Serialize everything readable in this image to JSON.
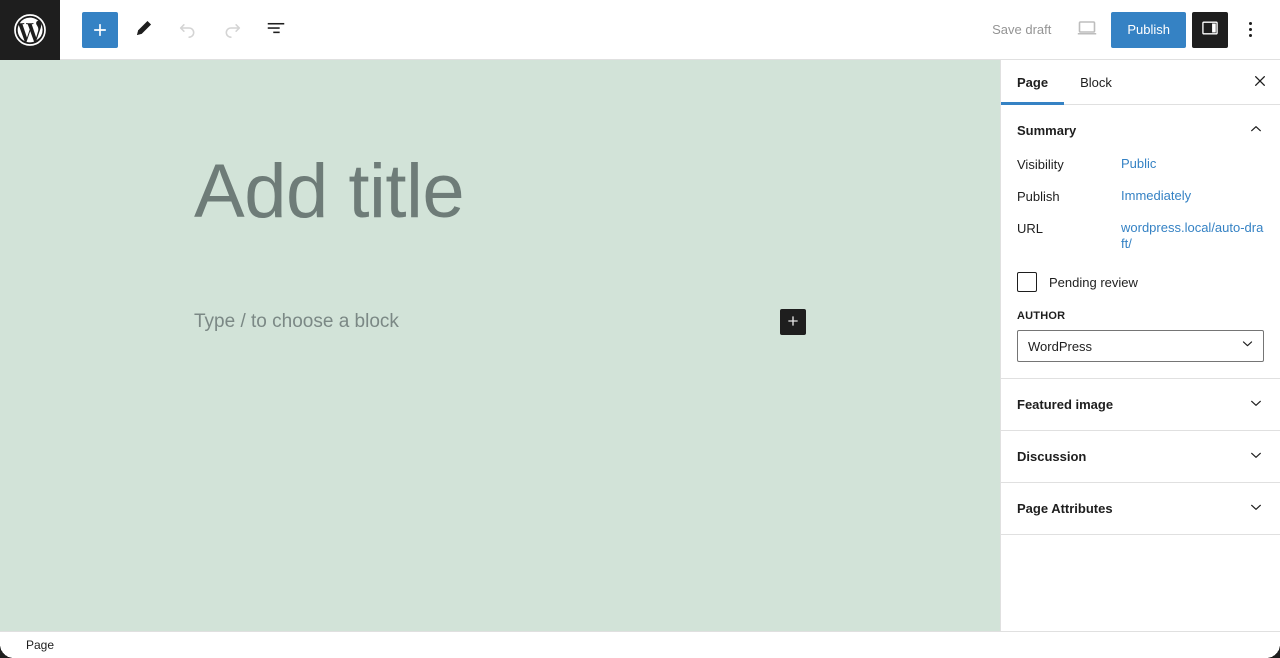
{
  "toolbar": {
    "logo_icon": "wordpress-logo",
    "add_block_label": "+",
    "add_block_icon": "plus-icon",
    "tools_icon": "pencil-icon",
    "undo_icon": "undo-arrow-icon",
    "redo_icon": "redo-arrow-icon",
    "list_view_icon": "list-view-icon",
    "save_draft_label": "Save draft",
    "preview_icon": "desktop-preview-icon",
    "publish_label": "Publish",
    "settings_icon": "sidebar-panel-icon",
    "more_icon": "three-dots-vertical-icon",
    "accent_color": "#3582c4",
    "dark_color": "#1e1e1e",
    "muted_color": "#949494"
  },
  "canvas": {
    "background_color": "#d2e3d8",
    "title_placeholder": "Add title",
    "block_placeholder": "Type / to choose a block",
    "inserter_icon": "plus-icon",
    "title_color": "#6e7c78"
  },
  "sidebar": {
    "tabs": [
      {
        "label": "Page",
        "active": true
      },
      {
        "label": "Block",
        "active": false
      }
    ],
    "close_icon": "close-x-icon",
    "summary": {
      "title": "Summary",
      "chevron_icon": "chevron-up-icon",
      "rows": [
        {
          "label": "Visibility",
          "value": "Public"
        },
        {
          "label": "Publish",
          "value": "Immediately"
        },
        {
          "label": "URL",
          "value": "wordpress.local/auto-draft/"
        }
      ],
      "pending_review": {
        "label": "Pending review",
        "checked": false
      },
      "author": {
        "label": "AUTHOR",
        "value": "WordPress",
        "chevron_icon": "chevron-down-icon"
      }
    },
    "panels": [
      {
        "title": "Featured image",
        "chevron_icon": "chevron-down-icon"
      },
      {
        "title": "Discussion",
        "chevron_icon": "chevron-down-icon"
      },
      {
        "title": "Page Attributes",
        "chevron_icon": "chevron-down-icon"
      }
    ],
    "link_color": "#3582c4"
  },
  "breadcrumb": {
    "items": [
      "Page"
    ]
  }
}
